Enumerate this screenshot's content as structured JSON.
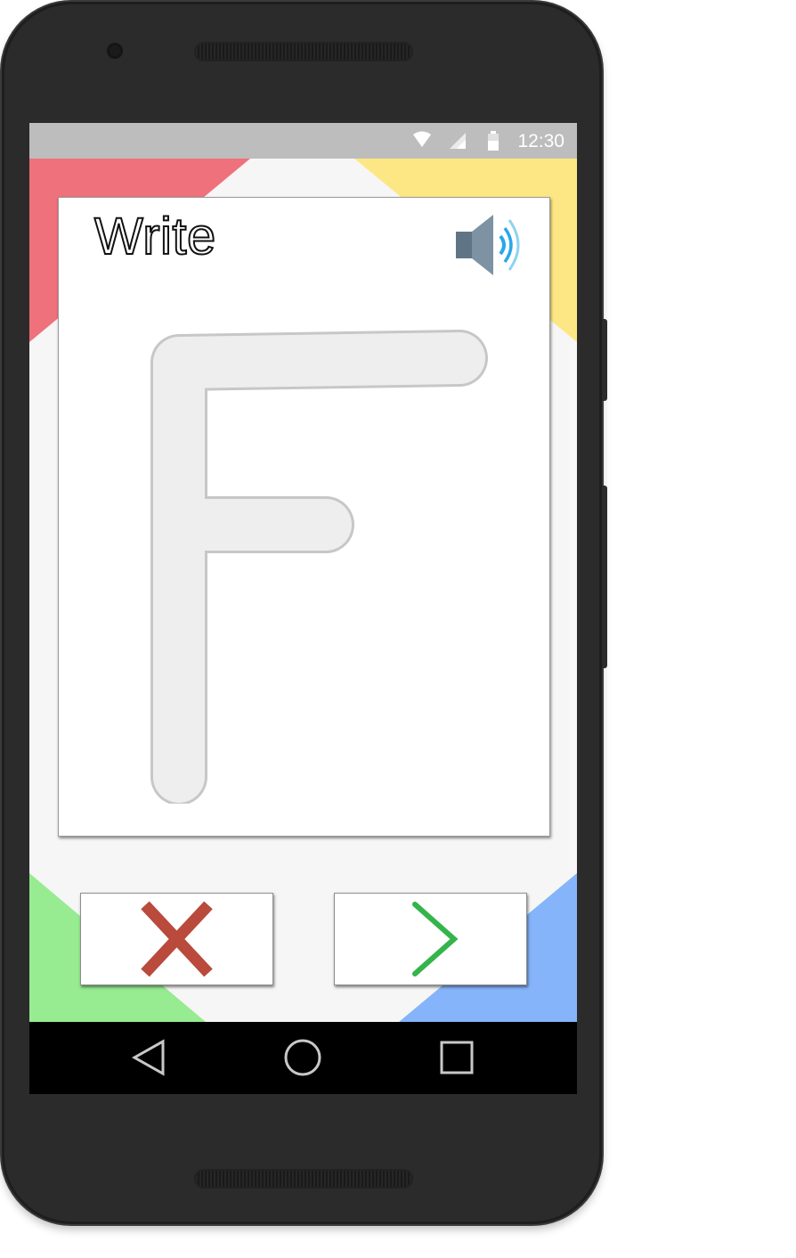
{
  "status_bar": {
    "time": "12:30"
  },
  "card": {
    "title": "Write",
    "letter": "F"
  },
  "icons": {
    "sound": "speaker-volume-icon",
    "wrong": "red-x-icon",
    "next": "green-chevron-right-icon",
    "back": "triangle-back-icon",
    "home": "circle-home-icon",
    "recents": "square-recents-icon"
  },
  "colors": {
    "corner_top_left": "#ef717b",
    "corner_top_right": "#fde785",
    "corner_bottom_left": "#97eb91",
    "corner_bottom_right": "#85b4fa",
    "wrong_mark": "#b94a3c",
    "next_mark": "#34b44a",
    "sound_waves": "#29a8e8"
  }
}
